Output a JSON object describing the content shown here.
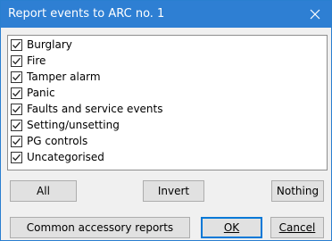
{
  "window": {
    "title": "Report events to ARC no. 1",
    "close_icon": "close-icon"
  },
  "events": {
    "items": [
      {
        "label": "Burglary",
        "checked": true
      },
      {
        "label": "Fire",
        "checked": true
      },
      {
        "label": "Tamper alarm",
        "checked": true
      },
      {
        "label": "Panic",
        "checked": true
      },
      {
        "label": "Faults and service events",
        "checked": true
      },
      {
        "label": "Setting/unsetting",
        "checked": true
      },
      {
        "label": "PG controls",
        "checked": true
      },
      {
        "label": "Uncategorised",
        "checked": true
      }
    ]
  },
  "buttons": {
    "all_label": "All",
    "invert_label": "Invert",
    "nothing_label": "Nothing",
    "common_label": "Common accessory reports",
    "ok_label": "OK",
    "cancel_label": "Cancel"
  },
  "colors": {
    "titlebar": "#2e7fd3",
    "dialog_bg": "#f0f0f0",
    "default_button_border": "#0078d7"
  }
}
